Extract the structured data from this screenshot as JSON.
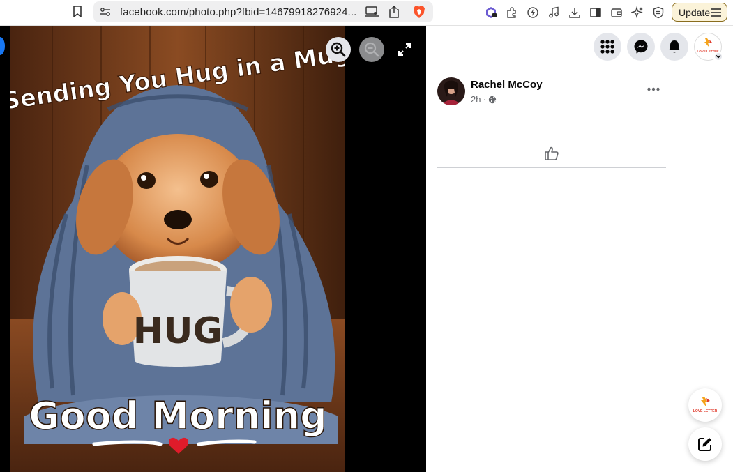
{
  "browser": {
    "url": "facebook.com/photo.php?fbid=14679918276924...",
    "update_label": "Update",
    "icons": [
      "bookmark-icon",
      "site-settings-icon",
      "cast-icon",
      "share-icon",
      "brave-shields-icon",
      "extension-leo-icon",
      "extensions-icon",
      "speedreader-icon",
      "media-icon",
      "downloads-icon",
      "sidebar-icon",
      "wallet-icon",
      "leo-ai-icon",
      "vpn-shield-icon",
      "menu-icon"
    ]
  },
  "viewer": {
    "photo": {
      "top_text": "Sending You Hug in a Mug",
      "mug_text": "HUG",
      "bottom_text": "Good Morning"
    },
    "controls": [
      "zoom-in-icon",
      "zoom-out-icon",
      "fullscreen-icon"
    ]
  },
  "fb_header": {
    "icons": [
      "menu-grid-icon",
      "messenger-icon",
      "notifications-bell-icon",
      "profile-avatar",
      "chevron-down-icon"
    ],
    "profile_logo_text": "LOVE LETTER"
  },
  "post": {
    "author": "Rachel McCoy",
    "time": "2h",
    "separator": "·",
    "privacy_icon": "globe-icon"
  },
  "floating": {
    "brand_logo_text": "LOVE LETTER",
    "compose_icon": "compose-icon"
  },
  "colors": {
    "fb_blue": "#1877f2",
    "fb_gray_bg": "#e4e6eb",
    "secondary_text": "#65676b",
    "update_border": "#8a6d1e",
    "brave_orange": "#fb542b"
  }
}
